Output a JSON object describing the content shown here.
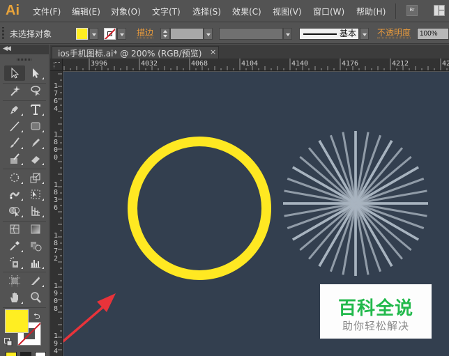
{
  "app": {
    "logo": "Ai",
    "menu": [
      "文件(F)",
      "编辑(E)",
      "对象(O)",
      "文字(T)",
      "选择(S)",
      "效果(C)",
      "视图(V)",
      "窗口(W)",
      "帮助(H)"
    ],
    "bridge_label": "Br"
  },
  "control_bar": {
    "selection_status": "未选择对象",
    "fill_color": "#ffee22",
    "stroke_color": "none",
    "stroke_label": "描边",
    "stroke_weight": "",
    "brush_label": "基本",
    "opacity_label": "不透明度",
    "opacity_value": "100%"
  },
  "document": {
    "tab_title": "ios手机图标.ai* @ 200% (RGB/预览)",
    "close_label": "×",
    "zoom": "200%",
    "color_mode": "RGB",
    "view_mode": "预览"
  },
  "rulers": {
    "horizontal": [
      "3996",
      "4032",
      "4068",
      "4104",
      "4140",
      "4176",
      "4212",
      "42"
    ],
    "vertical": [
      "1764",
      "1800",
      "1836",
      "1872",
      "1908",
      "194"
    ]
  },
  "toolbar": {
    "fill_color": "#ffee22",
    "stroke_color": "none",
    "tools": [
      "selection-tool",
      "direct-selection-tool",
      "magic-wand-tool",
      "lasso-tool",
      "pen-tool",
      "type-tool",
      "line-segment-tool",
      "rectangle-tool",
      "paintbrush-tool",
      "pencil-tool",
      "blob-brush-tool",
      "eraser-tool",
      "rotate-tool",
      "scale-tool",
      "puppet-warp-tool",
      "free-transform-tool",
      "shape-builder-tool",
      "perspective-grid-tool",
      "mesh-tool",
      "gradient-tool",
      "eyedropper-tool",
      "blend-tool",
      "symbol-sprayer-tool",
      "column-graph-tool",
      "artboard-tool",
      "slice-tool",
      "hand-tool",
      "zoom-tool"
    ]
  },
  "artwork": {
    "ring_color": "#ffe822",
    "canvas_color": "#333f4f",
    "burst_color": "#a9b4c0",
    "burst_ray_count": 36,
    "arrow_color": "#e8333a"
  },
  "watermark": {
    "title": "百科全说",
    "subtitle": "助你轻松解决",
    "title_color": "#21b94b"
  }
}
